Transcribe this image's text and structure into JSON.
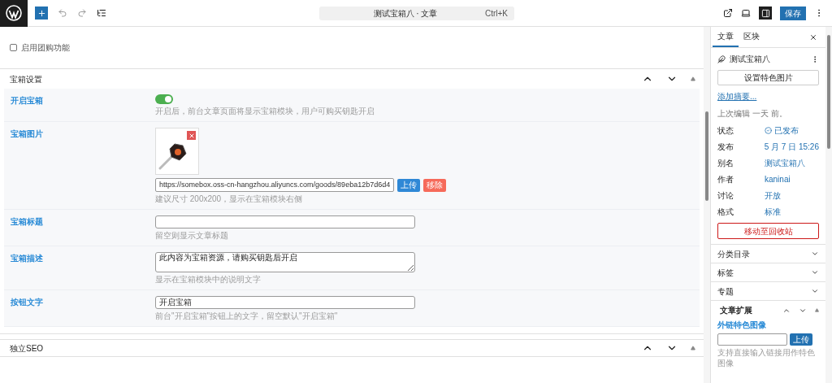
{
  "topbar": {
    "command_title": "测试宝箱八 · 文章",
    "shortcut": "Ctrl+K",
    "save": "保存",
    "sidebar_toggle_on": true
  },
  "group_section": {
    "checkbox_label": "启用团购功能",
    "checked": false
  },
  "box_section": {
    "title": "宝箱设置",
    "fields": [
      {
        "kind": "toggle",
        "label": "开启宝箱",
        "on": true,
        "help": "开启后，前台文章页面将显示宝箱模块，用户可购买钥匙开启"
      },
      {
        "kind": "image",
        "label": "宝箱图片",
        "value": "https://somebox.oss-cn-hangzhou.aliyuncs.com/goods/89eba12b7d6d4",
        "upload": "上传",
        "remove": "移除",
        "help": "建议尺寸 200x200，显示在宝箱模块右侧"
      },
      {
        "kind": "text",
        "label": "宝箱标题",
        "help": "留空则显示文章标题"
      },
      {
        "kind": "textarea",
        "label": "宝箱描述",
        "value": "此内容为宝箱资源，请购买钥匙后开启",
        "help": "显示在宝箱模块中的说明文字"
      },
      {
        "kind": "text",
        "label": "按钮文字",
        "value": "开启宝箱",
        "help": "前台\"开启宝箱\"按钮上的文字，留空默认\"开启宝箱\""
      }
    ]
  },
  "seo_section": {
    "title": "独立SEO"
  },
  "sidebar": {
    "tabs": [
      {
        "label": "文章",
        "selected": true
      },
      {
        "label": "区块",
        "selected": false
      }
    ],
    "post_title": "测试宝箱八",
    "featured_image_button": "设置特色图片",
    "excerpt_link": "添加摘要...",
    "last_edited": "上次编辑 一天 前。",
    "meta": [
      {
        "label": "状态",
        "value": "已发布",
        "kind": "status"
      },
      {
        "label": "发布",
        "value": "5 月 7 日 15:26",
        "kind": "link"
      },
      {
        "label": "别名",
        "value": "测试宝箱八",
        "kind": "link"
      },
      {
        "label": "作者",
        "value": "kaninai",
        "kind": "link"
      },
      {
        "label": "讨论",
        "value": "开放",
        "kind": "link"
      },
      {
        "label": "格式",
        "value": "标准",
        "kind": "link"
      }
    ],
    "trash_button": "移动至回收站",
    "panels": [
      {
        "title": "分类目录",
        "expanded": false
      },
      {
        "title": "标签",
        "expanded": false
      },
      {
        "title": "专题",
        "expanded": false
      }
    ],
    "extension": {
      "title": "文章扩展",
      "field_label": "外链特色图像",
      "upload": "上传",
      "help": "支持直接输入链接用作特色图像"
    }
  }
}
